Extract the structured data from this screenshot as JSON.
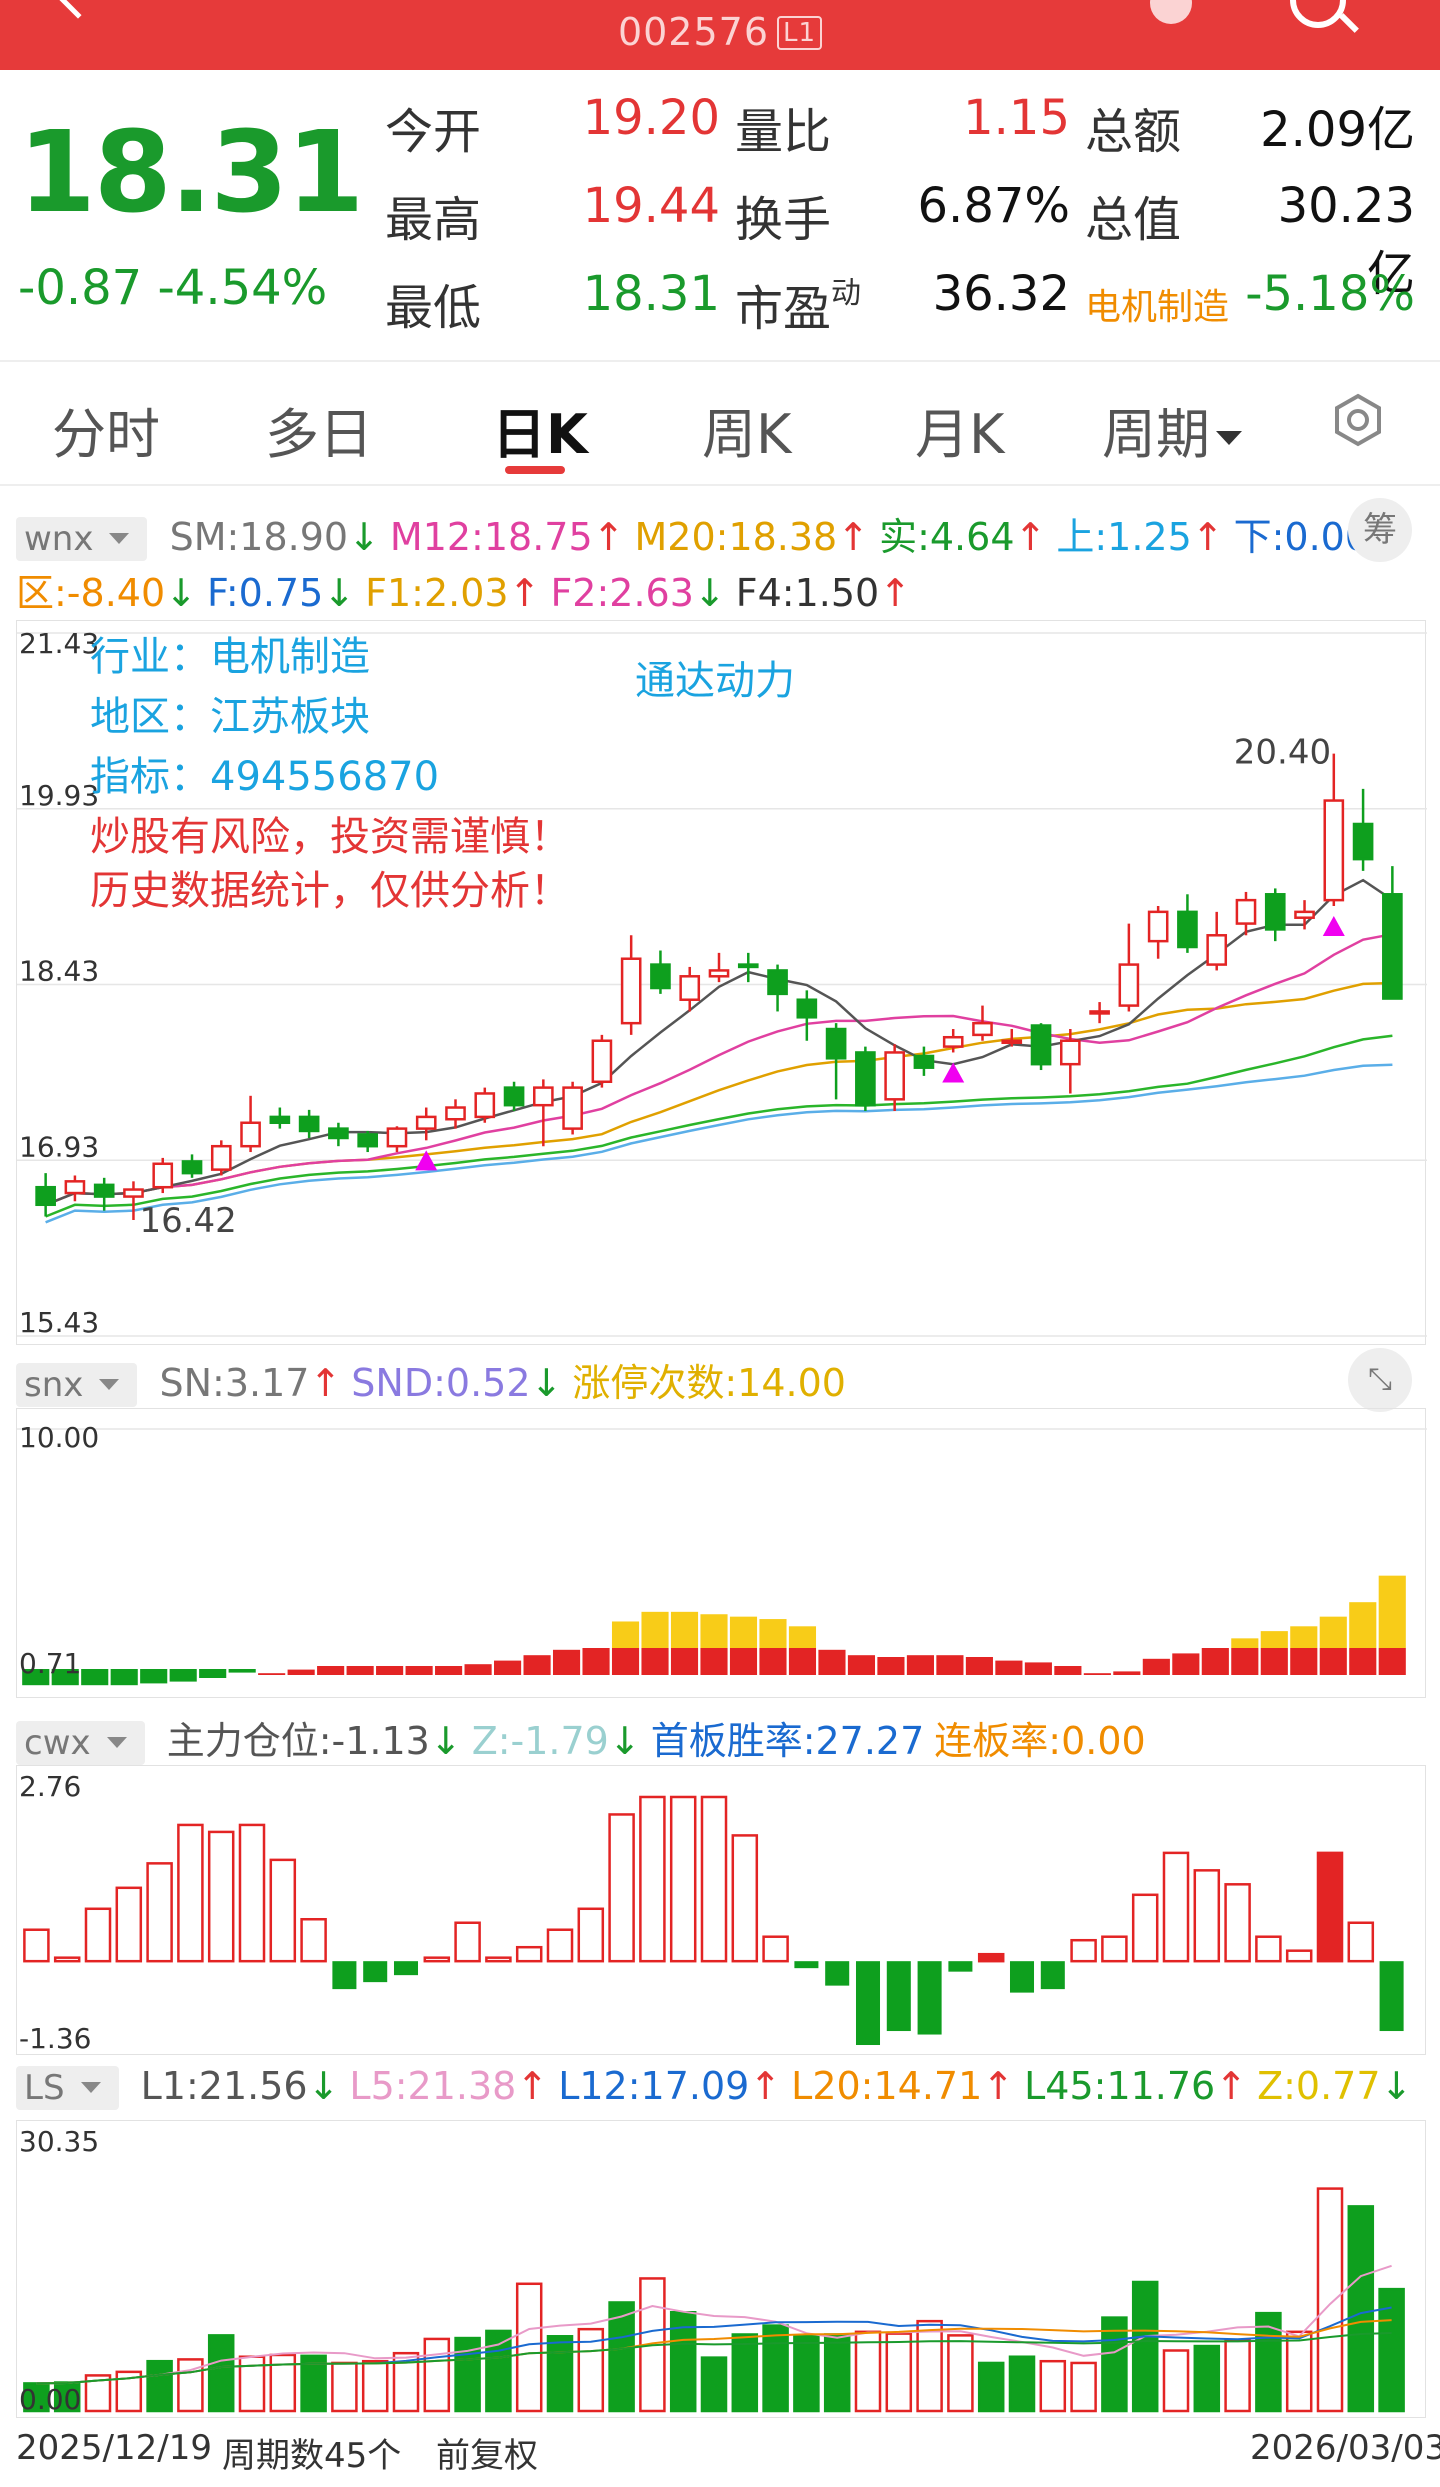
{
  "header": {
    "stock_code": "002576",
    "level_badge": "L1"
  },
  "quote": {
    "price": "18.31",
    "change": "-0.87",
    "change_pct": "-4.54%",
    "fields": [
      {
        "label": "今开",
        "value": "19.20",
        "color": "red"
      },
      {
        "label": "量比",
        "value": "1.15",
        "color": "red"
      },
      {
        "label": "总额",
        "value": "2.09亿",
        "color": "black"
      },
      {
        "label": "最高",
        "value": "19.44",
        "color": "red"
      },
      {
        "label": "换手",
        "value": "6.87%",
        "color": "black"
      },
      {
        "label": "总值",
        "value": "30.23亿",
        "color": "black"
      },
      {
        "label": "最低",
        "value": "18.31",
        "color": "green"
      },
      {
        "label": "市盈",
        "label_sup": "动",
        "value": "36.32",
        "color": "black"
      },
      {
        "label": "电机制造",
        "value": "-5.18%",
        "color": "green"
      }
    ]
  },
  "tabs": [
    {
      "label": "分时",
      "active": false
    },
    {
      "label": "多日",
      "active": false
    },
    {
      "label": "日K",
      "active": true
    },
    {
      "label": "周K",
      "active": false
    },
    {
      "label": "月K",
      "active": false
    },
    {
      "label": "周期",
      "active": false
    }
  ],
  "main_indicators": {
    "selector": "wnx",
    "button": "筹",
    "line1": [
      {
        "text": "SM:18.90",
        "arrow": "↓",
        "color": "#777777"
      },
      {
        "text": "M12:18.75",
        "arrow": "↑",
        "color": "#e040a0",
        "prefix_color": "#e89ac8"
      },
      {
        "text": "M20:18.38",
        "arrow": "↑",
        "color": "#e0a000"
      },
      {
        "text": "实:4.64",
        "arrow": "↑",
        "color": "#1a9a2c"
      },
      {
        "text": "上:1.25",
        "arrow": "↑",
        "color": "#1aa3e0"
      },
      {
        "text": "下:0.00",
        "arrow": "↓",
        "color": "#1a6ad0"
      }
    ],
    "line2": [
      {
        "text": "区:-8.40",
        "arrow": "↓",
        "color": "#f08c00"
      },
      {
        "text": "F:0.75",
        "arrow": "↓",
        "color": "#1a6ad0"
      },
      {
        "text": "F1:2.03",
        "arrow": "↑",
        "color": "#e0a000"
      },
      {
        "text": "F2:2.63",
        "arrow": "↓",
        "color": "#e040a0"
      },
      {
        "text": "F4:1.50",
        "arrow": "↑",
        "color": "#333333"
      }
    ]
  },
  "main_overlay": {
    "industry": "行业：电机制造",
    "region": "地区：江苏板块",
    "indicator": "指标：494556870",
    "name": "通达动力",
    "warn1": "炒股有风险，投资需谨慎！",
    "warn2": "历史数据统计，仅供分析！"
  },
  "snx": {
    "selector": "snx",
    "fields": [
      {
        "text": "SN:3.17",
        "arrow": "↑",
        "color": "#777777"
      },
      {
        "text": "SND:0.52",
        "arrow": "↓",
        "color": "#8a7ae0"
      },
      {
        "text": "涨停次数:14.00",
        "arrow": "",
        "color": "#e0b000"
      }
    ]
  },
  "cwx": {
    "selector": "cwx",
    "fields": [
      {
        "text": "主力仓位:-1.13",
        "arrow": "↓",
        "color": "#555555"
      },
      {
        "text": "Z:-1.79",
        "arrow": "↓",
        "color": "#9ad0d0"
      },
      {
        "text": "首板胜率:27.27",
        "arrow": "",
        "color": "#1a6ad0"
      },
      {
        "text": "连板率:0.00",
        "arrow": "",
        "color": "#f08c00"
      }
    ]
  },
  "ls": {
    "selector": "LS",
    "fields": [
      {
        "text": "L1:21.56",
        "arrow": "↓",
        "color": "#555555"
      },
      {
        "text": "L5:21.38",
        "arrow": "↑",
        "color": "#e89ac8"
      },
      {
        "text": "L12:17.09",
        "arrow": "↑",
        "color": "#1a6ad0"
      },
      {
        "text": "L20:14.71",
        "arrow": "↑",
        "color": "#f08c00"
      },
      {
        "text": "L45:11.76",
        "arrow": "↑",
        "color": "#1a9a2c"
      },
      {
        "text": "Z:0.77",
        "arrow": "↓",
        "color": "#e0c000"
      }
    ]
  },
  "footer": {
    "start_date": "2025/12/19",
    "period_count": "周期数45个",
    "adjust": "前复权",
    "end_date": "2026/03/03"
  },
  "chart_data": [
    {
      "type": "candlestick",
      "title": "",
      "y_ticks": [
        "21.43",
        "19.93",
        "18.43",
        "16.93",
        "15.43"
      ],
      "ylim": [
        15.43,
        21.43
      ],
      "annotations": [
        "20.40",
        "16.42"
      ],
      "candles": [
        [
          16.7,
          16.55,
          16.82,
          16.45
        ],
        [
          16.65,
          16.75,
          16.8,
          16.58
        ],
        [
          16.72,
          16.62,
          16.78,
          16.5
        ],
        [
          16.62,
          16.68,
          16.75,
          16.42
        ],
        [
          16.7,
          16.9,
          16.95,
          16.65
        ],
        [
          16.92,
          16.82,
          16.98,
          16.78
        ],
        [
          16.85,
          17.05,
          17.1,
          16.8
        ],
        [
          17.05,
          17.25,
          17.48,
          17.0
        ],
        [
          17.3,
          17.25,
          17.38,
          17.2
        ],
        [
          17.3,
          17.18,
          17.36,
          17.12
        ],
        [
          17.2,
          17.12,
          17.25,
          17.05
        ],
        [
          17.15,
          17.05,
          17.18,
          17.0
        ],
        [
          17.05,
          17.2,
          17.22,
          17.0
        ],
        [
          17.2,
          17.3,
          17.38,
          17.1
        ],
        [
          17.28,
          17.38,
          17.45,
          17.2
        ],
        [
          17.3,
          17.5,
          17.55,
          17.25
        ],
        [
          17.55,
          17.4,
          17.6,
          17.35
        ],
        [
          17.4,
          17.55,
          17.62,
          17.05
        ],
        [
          17.2,
          17.55,
          17.6,
          17.15
        ],
        [
          17.6,
          17.95,
          18.0,
          17.55
        ],
        [
          18.1,
          18.65,
          18.85,
          18.0
        ],
        [
          18.6,
          18.4,
          18.72,
          18.35
        ],
        [
          18.3,
          18.5,
          18.58,
          18.2
        ],
        [
          18.5,
          18.55,
          18.7,
          18.45
        ],
        [
          18.6,
          18.58,
          18.7,
          18.45
        ],
        [
          18.55,
          18.35,
          18.6,
          18.2
        ],
        [
          18.3,
          18.15,
          18.38,
          17.95
        ],
        [
          18.05,
          17.8,
          18.1,
          17.45
        ],
        [
          17.85,
          17.4,
          17.9,
          17.35
        ],
        [
          17.45,
          17.85,
          17.92,
          17.35
        ],
        [
          17.82,
          17.72,
          17.9,
          17.65
        ],
        [
          17.9,
          17.98,
          18.05,
          17.85
        ],
        [
          18.0,
          18.1,
          18.25,
          17.95
        ],
        [
          17.95,
          17.95,
          18.05,
          17.9
        ],
        [
          18.08,
          17.75,
          18.1,
          17.7
        ],
        [
          17.75,
          17.95,
          18.05,
          17.5
        ],
        [
          18.2,
          18.2,
          18.28,
          18.1
        ],
        [
          18.25,
          18.6,
          18.95,
          18.2
        ],
        [
          18.8,
          19.05,
          19.1,
          18.65
        ],
        [
          19.05,
          18.75,
          19.2,
          18.7
        ],
        [
          18.6,
          18.85,
          19.05,
          18.55
        ],
        [
          18.95,
          19.15,
          19.22,
          18.85
        ],
        [
          19.2,
          18.9,
          19.25,
          18.8
        ],
        [
          19.0,
          19.05,
          19.15,
          18.9
        ],
        [
          19.15,
          20.0,
          20.4,
          19.1
        ],
        [
          19.8,
          19.5,
          20.1,
          19.4
        ],
        [
          19.2,
          18.31,
          19.44,
          18.31
        ]
      ]
    },
    {
      "type": "bar",
      "title": "",
      "y_ticks": [
        "10.00",
        "0.71"
      ],
      "ylim": [
        0.71,
        10.0
      ],
      "values": [
        -0.9,
        -0.9,
        -0.9,
        -0.9,
        -0.8,
        -0.7,
        -0.5,
        -0.2,
        0.1,
        0.3,
        0.5,
        0.5,
        0.5,
        0.5,
        0.5,
        0.6,
        0.8,
        1.1,
        1.4,
        1.5,
        2.6,
        3.0,
        3.0,
        2.9,
        2.8,
        2.7,
        2.4,
        1.4,
        1.1,
        1.0,
        1.1,
        1.1,
        1.0,
        0.8,
        0.7,
        0.5,
        0.1,
        0.2,
        0.9,
        1.2,
        1.5,
        1.9,
        2.2,
        2.4,
        2.8,
        3.4,
        4.5
      ],
      "limit": 1.5
    },
    {
      "type": "bar",
      "title": "",
      "y_ticks": [
        "2.76",
        "-1.36"
      ],
      "ylim": [
        -1.36,
        2.76
      ],
      "values": [
        0.9,
        0.1,
        1.5,
        2.1,
        2.8,
        3.9,
        3.7,
        3.9,
        2.9,
        1.2,
        -0.8,
        -0.6,
        -0.4,
        0.1,
        1.1,
        0.1,
        0.4,
        0.9,
        1.5,
        4.2,
        4.7,
        4.7,
        4.7,
        3.6,
        0.7,
        -0.2,
        -0.7,
        -2.4,
        -2.0,
        -2.1,
        -0.3,
        0.2,
        -0.9,
        -0.8,
        0.6,
        0.7,
        1.9,
        3.1,
        2.6,
        2.2,
        0.7,
        0.3,
        3.1,
        1.1,
        -2.0
      ],
      "last_solid_red_index": 42
    },
    {
      "type": "bar",
      "title": "",
      "y_ticks": [
        "30.35",
        "0.00"
      ],
      "ylim": [
        0.0,
        30.35
      ],
      "values": [
        3.1,
        3.2,
        4.0,
        4.4,
        5.6,
        5.8,
        8.5,
        6.1,
        6.3,
        6.2,
        5.4,
        5.6,
        6.5,
        8.1,
        8.2,
        9.0,
        14.3,
        8.4,
        9.2,
        12.2,
        14.9,
        11.1,
        6.0,
        8.6,
        9.6,
        8.4,
        8.6,
        8.9,
        8.7,
        10.1,
        8.5,
        5.4,
        6.1,
        5.6,
        5.4,
        10.5,
        14.5,
        6.8,
        7.3,
        7.9,
        11.0,
        8.9,
        25.0,
        23.0,
        13.7
      ],
      "green": [
        0,
        1,
        4,
        6,
        9,
        14,
        15,
        17,
        19,
        21,
        22,
        23,
        24,
        25,
        26,
        31,
        32,
        35,
        36,
        38,
        40,
        43,
        44
      ]
    }
  ]
}
